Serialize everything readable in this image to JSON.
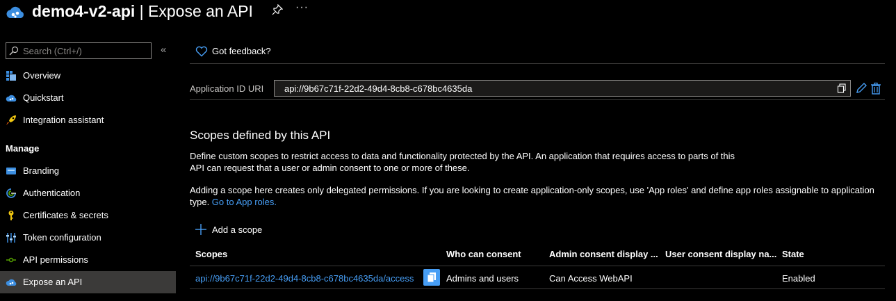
{
  "header": {
    "app_name": "demo4-v2-api",
    "separator": " | ",
    "page_title": "Expose an API",
    "more_label": "···"
  },
  "sidebar": {
    "search_placeholder": "Search (Ctrl+/)",
    "collapse_label": "«",
    "items_top": [
      {
        "label": "Overview",
        "icon": "overview-icon"
      },
      {
        "label": "Quickstart",
        "icon": "quickstart-icon"
      },
      {
        "label": "Integration assistant",
        "icon": "rocket-icon"
      }
    ],
    "manage_label": "Manage",
    "items_manage": [
      {
        "label": "Branding",
        "icon": "branding-icon"
      },
      {
        "label": "Authentication",
        "icon": "authentication-icon"
      },
      {
        "label": "Certificates & secrets",
        "icon": "key-icon"
      },
      {
        "label": "Token configuration",
        "icon": "token-config-icon"
      },
      {
        "label": "API permissions",
        "icon": "api-permissions-icon"
      },
      {
        "label": "Expose an API",
        "icon": "cloud-icon",
        "selected": true
      }
    ]
  },
  "main": {
    "feedback_label": "Got feedback?",
    "app_id_label": "Application ID URI",
    "app_id_value": "api://9b67c71f-22d2-49d4-8cb8-c678bc4635da",
    "scopes_title": "Scopes defined by this API",
    "desc1_line1": "Define custom scopes to restrict access to data and functionality protected by the API. An application that requires access to parts of this",
    "desc1_line2": "API can request that a user or admin consent to one or more of these.",
    "desc2_line1": "Adding a scope here creates only delegated permissions. If you are looking to create application-only scopes, use 'App roles' and define app roles assignable to application",
    "desc2_line2_prefix": "type. ",
    "desc2_link": "Go to App roles.",
    "add_scope_label": "Add a scope",
    "table": {
      "headers": [
        "Scopes",
        "Who can consent",
        "Admin consent display ...",
        "User consent display na...",
        "State"
      ],
      "rows": [
        {
          "scope": "api://9b67c71f-22d2-49d4-8cb8-c678bc4635da/access",
          "who_can_consent": "Admins and users",
          "admin_consent_display": "Can Access WebAPI",
          "user_consent_display": "",
          "state": "Enabled"
        }
      ]
    }
  },
  "colors": {
    "background": "#000000",
    "link": "#479ef5",
    "selected_nav": "#3b3a39",
    "divider": "#3b3a39",
    "input_border": "#8a8886"
  }
}
